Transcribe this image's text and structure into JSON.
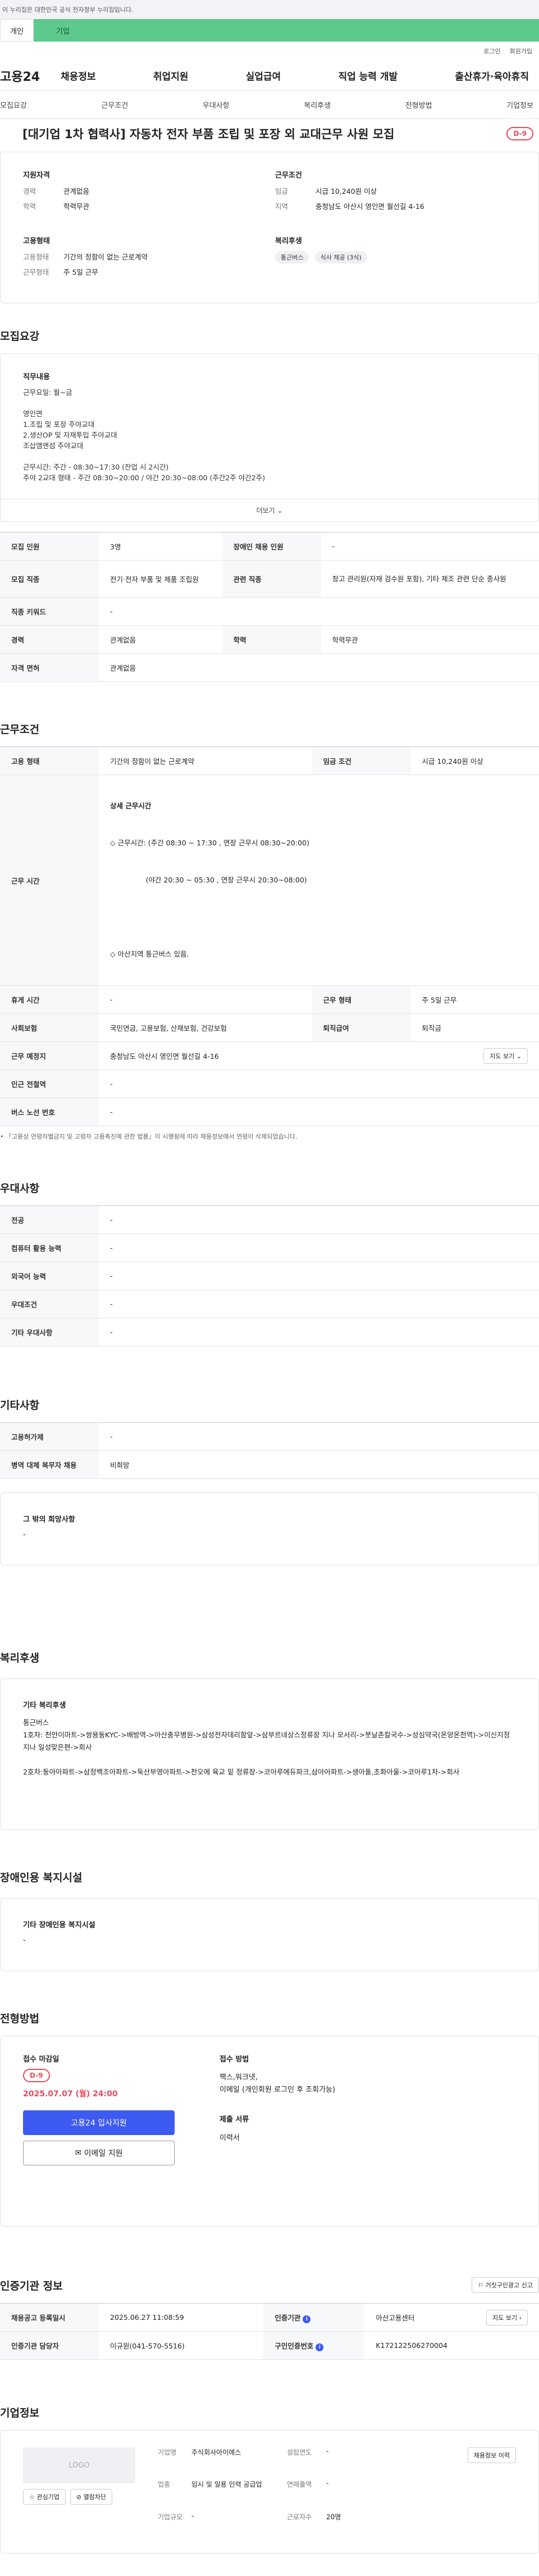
{
  "notice": "이 누리집은 대한민국 공식 전자정부 누리집입니다.",
  "type_tabs": [
    "개인",
    "기업"
  ],
  "util": [
    "로그인",
    "회원가입"
  ],
  "gnb": {
    "logo": "고용24",
    "menu": [
      "채용정보",
      "취업지원",
      "실업급여",
      "직업 능력 개발",
      "출산휴가·육아휴직"
    ]
  },
  "subtabs": [
    "모집요강",
    "근무조건",
    "우대사항",
    "복리후생",
    "전형방법",
    "기업정보"
  ],
  "title": "[대기업 1차 협력사] 자동차 전자 부품 조립 및 포장 외 교대근무 사원 모집",
  "dday": "D-9",
  "summary": {
    "qual_title": "지원자격",
    "career_k": "경력",
    "career_v": "관계없음",
    "edu_k": "학력",
    "edu_v": "학력무관",
    "emp_title": "고용형태",
    "emptype_k": "고용형태",
    "emptype_v": "기간의 정함이 없는 근로계약",
    "workform_k": "근무형태",
    "workform_v": "주 5일 근무",
    "cond_title": "근무조건",
    "wage_k": "임금",
    "wage_v": "시급 10,240원 이상",
    "region_k": "지역",
    "region_v": "충청남도 아산시 영인면 월선길 4-16",
    "welfare_title": "복리후생",
    "tags": [
      "통근버스",
      "식사 제공 (3식)"
    ]
  },
  "recruit": {
    "title": "모집요강",
    "desc_title": "직무내용",
    "lines": [
      "근무요일: 월~금",
      "",
      "영인면",
      "1.조립 및 포장 주야교대",
      "2.생산OP 및 자재투입 주야교대",
      "조삽앰앤섬 주야교대",
      "",
      "근무시간: 주간 - 08:30~17:30 (잔업 시 2시간)",
      "주야 2교대 형태 - 주간 08:30~20:00 / 야간 20:30~08:00 (주간2주 야간2주)"
    ],
    "more": "더보기",
    "rows": [
      {
        "k1": "모집 인원",
        "v1": "3명",
        "k2": "장애인 채용 인원",
        "v2": "-"
      },
      {
        "k1": "모집 직종",
        "v1": "전기·전자 부품 및 제품 조립원",
        "k2": "관련 직종",
        "v2": "창고 관리원(자재 검수원 포함), 기타 제조 관련 단순 종사원"
      },
      {
        "k1": "직종 키워드",
        "v1": "-"
      },
      {
        "k1": "경력",
        "v1": "관계없음",
        "k2": "학력",
        "v2": "학력무관"
      },
      {
        "k1": "자격 면허",
        "v1": "관계없음"
      }
    ]
  },
  "conditions": {
    "title": "근무조건",
    "emp_k": "고용 형태",
    "emp_v": "기간의 정함이 없는 근로계약",
    "wage_k": "임금 조건",
    "wage_v": "시급 10,240원 이상",
    "time_k": "근무 시간",
    "time_lines": [
      "상세 근무시간",
      "◇ 근무시간: (주간 08:30 ~ 17:30 , 연장 근무시 08:30~20:00)",
      "                (야간 20:30 ~ 05:30 , 연장 근무시 20:30~08:00)",
      "",
      "◇ 아산지역 통근버스 있음."
    ],
    "rest_k": "휴게 시간",
    "rest_v": "-",
    "form_k": "근무 형태",
    "form_v": "주 5일 근무",
    "ins_k": "사회보험",
    "ins_v": "국민연금, 고용보험, 산재보험, 건강보험",
    "sev_k": "퇴직급여",
    "sev_v": "퇴직금",
    "place_k": "근무 예정지",
    "place_v": "충청남도 아산시 영인면 월선길 4-16",
    "map_btn": "지도 보기",
    "subway_k": "인근 전철역",
    "subway_v": "-",
    "bus_k": "버스 노선 번호",
    "bus_v": "-",
    "note": "• 「고용상 연령차별금지 및 고령자 고용촉진에 관한 법률」이 시행됨에 따라 채용정보에서 연령이 삭제되었습니다."
  },
  "pref": {
    "title": "우대사항",
    "rows": [
      [
        "전공",
        "-"
      ],
      [
        "컴퓨터 활용 능력",
        "-"
      ],
      [
        "외국어 능력",
        "-"
      ],
      [
        "우대조건",
        "-"
      ],
      [
        "기타 우대사항",
        "-"
      ]
    ]
  },
  "etc": {
    "title": "기타사항",
    "rows": [
      [
        "고용허가제",
        "-"
      ],
      [
        "병역 대체 복무자 채용",
        "비희망"
      ]
    ],
    "box_title": "그 밖의 희망사항",
    "box_v": "-"
  },
  "welfare": {
    "title": "복리후생",
    "box_title": "기타 복리후생",
    "lines": [
      "통근버스",
      "1호차: 천안이마트->쌍용동KYC->배방역->아산충무병원->삼성전자데리함앞->삼부르네상스정류장 지나 모서리->붓날촌칼국수->성심약국(온양온천역)->이신지정 지나 일성맞은편->회사",
      "",
      "2호차:동아아파트->삼정백조아파트->둑산부영아파트->천오에 육교 밑 정류장->코아루에듀파크,삼아아파트->생아돌,초화아울->코아루1차->회사"
    ]
  },
  "disabled": {
    "title": "장애인용 복지시설",
    "box_title": "기타 장애인용 복지시설",
    "box_v": "-"
  },
  "apply": {
    "title": "전형방법",
    "deadline_title": "접수 마감일",
    "dday": "D-9",
    "deadline": "2025.07.07 (월) 24:00",
    "btn_apply": "고용24 입사지원",
    "btn_email": "이메일 지원",
    "method_title": "접수 방법",
    "method_lines": [
      "팩스,워크넷,",
      "이메일 (개인회원 로그인 후 조회가능)"
    ],
    "docs_title": "제출 서류",
    "docs_v": "이력서"
  },
  "agency": {
    "title": "인증기관 정보",
    "report_btn": "거짓구인광고 신고",
    "reg_k": "채용공고 등록일시",
    "reg_v": "2025.06.27 11:08:59",
    "org_k": "인증기관",
    "org_v": "아산고용센터",
    "map_btn": "지도 보기",
    "mgr_k": "인증기관 담당자",
    "mgr_v": "이규원(041-570-5516)",
    "no_k": "구인인증번호",
    "no_v": "K172122506270004"
  },
  "company": {
    "title": "기업정보",
    "logo": "LOGO",
    "fav": "관심기업",
    "block": "열람차단",
    "name_k": "기업명",
    "name_v": "주식회사아이에스",
    "ind_k": "업종",
    "ind_v": "임시 및 일용 인력 공급업",
    "scale_k": "기업규모",
    "scale_v": "-",
    "est_k": "설립연도",
    "est_v": "-",
    "sales_k": "연매출액",
    "sales_v": "-",
    "emp_k": "근로자수",
    "emp_v": "20명",
    "jobs_btn": "채용정보 이력"
  }
}
